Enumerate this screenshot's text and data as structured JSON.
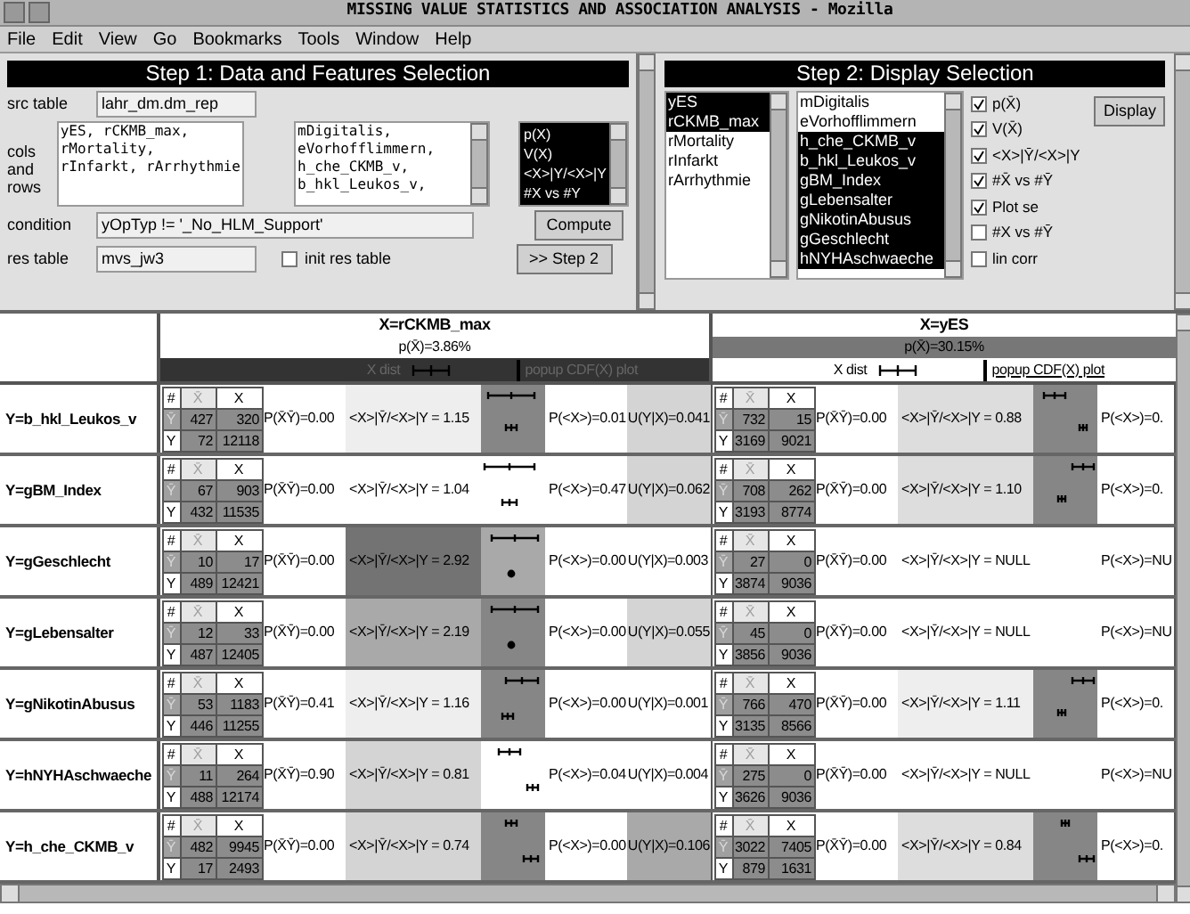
{
  "window": {
    "title": "MISSING VALUE STATISTICS AND ASSOCIATION ANALYSIS - Mozilla"
  },
  "menu": [
    "File",
    "Edit",
    "View",
    "Go",
    "Bookmarks",
    "Tools",
    "Window",
    "Help"
  ],
  "step1": {
    "title": "Step 1: Data and Features Selection",
    "src_label": "src table",
    "src_value": "lahr_dm.dm_rep",
    "cols_label": "cols and rows",
    "cols_value": "yES, rCKMB_max,\nrMortality,\nrInfarkt, rArrhythmie",
    "features_value": "mDigitalis,\neVorhofflimmern,\nh_che_CKMB_v,\nb_hkl_Leukos_v,",
    "stats_options": [
      {
        "label": "p(X)",
        "selected": true
      },
      {
        "label": "V(X)",
        "selected": true
      },
      {
        "label": "<X>|Y/<X>|Y",
        "selected": true
      },
      {
        "label": "#X vs #Y",
        "selected": true
      }
    ],
    "condition_label": "condition",
    "condition_value": "yOpTyp != '_No_HLM_Support'",
    "compute": "Compute",
    "res_label": "res table",
    "res_value": "mvs_jw3",
    "init": {
      "label": "init res table",
      "checked": false
    },
    "next": ">> Step 2"
  },
  "step2": {
    "title": "Step 2: Display Selection",
    "x_items": [
      {
        "label": "yES",
        "selected": true
      },
      {
        "label": "rCKMB_max",
        "selected": true
      },
      {
        "label": "rMortality",
        "selected": false
      },
      {
        "label": "rInfarkt",
        "selected": false
      },
      {
        "label": "rArrhythmie",
        "selected": false
      }
    ],
    "y_items": [
      {
        "label": "mDigitalis",
        "selected": false
      },
      {
        "label": "eVorhofflimmern",
        "selected": false
      },
      {
        "label": "h_che_CKMB_v",
        "selected": true
      },
      {
        "label": "b_hkl_Leukos_v",
        "selected": true
      },
      {
        "label": "gBM_Index",
        "selected": true
      },
      {
        "label": "gLebensalter",
        "selected": true
      },
      {
        "label": "gNikotinAbusus",
        "selected": true
      },
      {
        "label": "gGeschlecht",
        "selected": true
      },
      {
        "label": "hNYHAschwaeche",
        "selected": true
      }
    ],
    "options": [
      {
        "label": "p(X̄)",
        "checked": true
      },
      {
        "label": "V(X̄)",
        "checked": true
      },
      {
        "label": "<X>|Ȳ/<X>|Y",
        "checked": true
      },
      {
        "label": "#X̄ vs #Ȳ",
        "checked": true
      },
      {
        "label": "Plot se",
        "checked": true
      },
      {
        "label": "#X vs #Ȳ",
        "checked": false
      },
      {
        "label": "lin corr",
        "checked": false
      }
    ],
    "display": "Display"
  },
  "table": {
    "columns": [
      {
        "name": "X=rCKMB_max",
        "p": "p(X̄)=3.86%",
        "p_dark": false,
        "dist_dark": true,
        "dist_label": "X dist",
        "cdf_link": "popup CDF(X) plot"
      },
      {
        "name": "X=yES",
        "p": "p(X̄)=30.15%",
        "p_dark": true,
        "dist_dark": false,
        "dist_label": "X dist",
        "cdf_link": "popup CDF(X) plot"
      }
    ],
    "rows": [
      {
        "label": "Y=b_hkl_Leukos_v",
        "cells": [
          {
            "header": [
              "#",
              "X̄",
              "X"
            ],
            "rows": [
              {
                "label": "Ȳ",
                "values": [
                  "427",
                  "320"
                ]
              },
              {
                "label": "Y",
                "values": [
                  "72",
                  "12118"
                ]
              }
            ],
            "p": "P(X̄Ȳ)=0.00",
            "ratio": {
              "text": "<X>|Ȳ/<X>|Y = 1.15",
              "color": "#eeeeee"
            },
            "plot": {
              "kind": "intervals",
              "color": "#868686"
            },
            "mean": "P(<X>)=0.01",
            "u": {
              "text": "U(Y|X)=0.041",
              "color": "#d4d4d4"
            }
          },
          {
            "header": [
              "#",
              "X̄",
              "X"
            ],
            "rows": [
              {
                "label": "Ȳ",
                "values": [
                  "732",
                  "15"
                ]
              },
              {
                "label": "Y",
                "values": [
                  "3169",
                  "9021"
                ]
              }
            ],
            "p": "P(X̄Ȳ)=0.00",
            "ratio": {
              "text": "<X>|Ȳ/<X>|Y = 0.88",
              "color": "#dddddd"
            },
            "plot": {
              "kind": "intervals",
              "color": "#868686"
            },
            "mean": "P(<X>)=0."
          }
        ]
      },
      {
        "label": "Y=gBM_Index",
        "cells": [
          {
            "header": [
              "#",
              "X̄",
              "X"
            ],
            "rows": [
              {
                "label": "Ȳ",
                "values": [
                  "67",
                  "903"
                ]
              },
              {
                "label": "Y",
                "values": [
                  "432",
                  "11535"
                ]
              }
            ],
            "p": "P(X̄Ȳ)=0.00",
            "ratio": {
              "text": "<X>|Ȳ/<X>|Y = 1.04"
            },
            "plot": {
              "kind": "intervals"
            },
            "mean": "P(<X>)=0.47",
            "u": {
              "text": "U(Y|X)=0.062",
              "color": "#d4d4d4"
            }
          },
          {
            "header": [
              "#",
              "X̄",
              "X"
            ],
            "rows": [
              {
                "label": "Ȳ",
                "values": [
                  "708",
                  "262"
                ]
              },
              {
                "label": "Y",
                "values": [
                  "3193",
                  "8774"
                ]
              }
            ],
            "p": "P(X̄Ȳ)=0.00",
            "ratio": {
              "text": "<X>|Ȳ/<X>|Y = 1.10",
              "color": "#dddddd"
            },
            "plot": {
              "kind": "intervals",
              "color": "#868686"
            },
            "mean": "P(<X>)=0."
          }
        ]
      },
      {
        "label": "Y=gGeschlecht",
        "cells": [
          {
            "header": [
              "#",
              "X̄",
              "X"
            ],
            "rows": [
              {
                "label": "Ȳ",
                "values": [
                  "10",
                  "17"
                ]
              },
              {
                "label": "Y",
                "values": [
                  "489",
                  "12421"
                ]
              }
            ],
            "p": "P(X̄Ȳ)=0.00",
            "ratio": {
              "text": "<X>|Ȳ/<X>|Y = 2.92",
              "color": "#737373"
            },
            "plot": {
              "kind": "intervals",
              "color": "#a9a9a9"
            },
            "mean": "P(<X>)=0.00",
            "u": {
              "text": "U(Y|X)=0.003"
            }
          },
          {
            "header": [
              "#",
              "X̄",
              "X"
            ],
            "rows": [
              {
                "label": "Ȳ",
                "values": [
                  "27",
                  "0"
                ]
              },
              {
                "label": "Y",
                "values": [
                  "3874",
                  "9036"
                ]
              }
            ],
            "p": "P(X̄Ȳ)=0.00",
            "ratio": {
              "text": "<X>|Ȳ/<X>|Y = NULL"
            },
            "mean": "P(<X>)=NU"
          }
        ]
      },
      {
        "label": "Y=gLebensalter",
        "cells": [
          {
            "header": [
              "#",
              "X̄",
              "X"
            ],
            "rows": [
              {
                "label": "Ȳ",
                "values": [
                  "12",
                  "33"
                ]
              },
              {
                "label": "Y",
                "values": [
                  "487",
                  "12405"
                ]
              }
            ],
            "p": "P(X̄Ȳ)=0.00",
            "ratio": {
              "text": "<X>|Ȳ/<X>|Y = 2.19",
              "color": "#a9a9a9"
            },
            "plot": {
              "kind": "intervals",
              "color": "#868686"
            },
            "mean": "P(<X>)=0.00",
            "u": {
              "text": "U(Y|X)=0.055",
              "color": "#d4d4d4"
            }
          },
          {
            "header": [
              "#",
              "X̄",
              "X"
            ],
            "rows": [
              {
                "label": "Ȳ",
                "values": [
                  "45",
                  "0"
                ]
              },
              {
                "label": "Y",
                "values": [
                  "3856",
                  "9036"
                ]
              }
            ],
            "p": "P(X̄Ȳ)=0.00",
            "ratio": {
              "text": "<X>|Ȳ/<X>|Y = NULL"
            },
            "mean": "P(<X>)=NU"
          }
        ]
      },
      {
        "label": "Y=gNikotinAbusus",
        "cells": [
          {
            "header": [
              "#",
              "X̄",
              "X"
            ],
            "rows": [
              {
                "label": "Ȳ",
                "values": [
                  "53",
                  "1183"
                ]
              },
              {
                "label": "Y",
                "values": [
                  "446",
                  "11255"
                ]
              }
            ],
            "p": "P(X̄Ȳ)=0.41",
            "ratio": {
              "text": "<X>|Ȳ/<X>|Y = 1.16",
              "color": "#eeeeee"
            },
            "plot": {
              "kind": "intervals",
              "color": "#868686"
            },
            "mean": "P(<X>)=0.00",
            "u": {
              "text": "U(Y|X)=0.001"
            }
          },
          {
            "header": [
              "#",
              "X̄",
              "X"
            ],
            "rows": [
              {
                "label": "Ȳ",
                "values": [
                  "766",
                  "470"
                ]
              },
              {
                "label": "Y",
                "values": [
                  "3135",
                  "8566"
                ]
              }
            ],
            "p": "P(X̄Ȳ)=0.00",
            "ratio": {
              "text": "<X>|Ȳ/<X>|Y = 1.11",
              "color": "#eeeeee"
            },
            "plot": {
              "kind": "intervals",
              "color": "#868686"
            },
            "mean": "P(<X>)=0."
          }
        ]
      },
      {
        "label": "Y=hNYHAschwaeche",
        "cells": [
          {
            "header": [
              "#",
              "X̄",
              "X"
            ],
            "rows": [
              {
                "label": "Ȳ",
                "values": [
                  "11",
                  "264"
                ]
              },
              {
                "label": "Y",
                "values": [
                  "488",
                  "12174"
                ]
              }
            ],
            "p": "P(X̄Ȳ)=0.90",
            "ratio": {
              "text": "<X>|Ȳ/<X>|Y = 0.81",
              "color": "#d4d4d4"
            },
            "plot": {
              "kind": "intervals"
            },
            "mean": "P(<X>)=0.04",
            "u": {
              "text": "U(Y|X)=0.004"
            }
          },
          {
            "header": [
              "#",
              "X̄",
              "X"
            ],
            "rows": [
              {
                "label": "Ȳ",
                "values": [
                  "275",
                  "0"
                ]
              },
              {
                "label": "Y",
                "values": [
                  "3626",
                  "9036"
                ]
              }
            ],
            "p": "P(X̄Ȳ)=0.00",
            "ratio": {
              "text": "<X>|Ȳ/<X>|Y = NULL"
            },
            "mean": "P(<X>)=NU"
          }
        ]
      },
      {
        "label": "Y=h_che_CKMB_v",
        "cells": [
          {
            "header": [
              "#",
              "X̄",
              "X"
            ],
            "rows": [
              {
                "label": "Ȳ",
                "values": [
                  "482",
                  "9945"
                ]
              },
              {
                "label": "Y",
                "values": [
                  "17",
                  "2493"
                ]
              }
            ],
            "p": "P(X̄Ȳ)=0.00",
            "ratio": {
              "text": "<X>|Ȳ/<X>|Y = 0.74",
              "color": "#d4d4d4"
            },
            "plot": {
              "kind": "intervals",
              "color": "#868686"
            },
            "mean": "P(<X>)=0.00",
            "u": {
              "text": "U(Y|X)=0.106",
              "color": "#a9a9a9"
            }
          },
          {
            "header": [
              "#",
              "X̄",
              "X"
            ],
            "rows": [
              {
                "label": "Ȳ",
                "values": [
                  "3022",
                  "7405"
                ]
              },
              {
                "label": "Y",
                "values": [
                  "879",
                  "1631"
                ]
              }
            ],
            "p": "P(X̄Ȳ)=0.00",
            "ratio": {
              "text": "<X>|Ȳ/<X>|Y = 0.84",
              "color": "#dddddd"
            },
            "plot": {
              "kind": "intervals",
              "color": "#868686"
            },
            "mean": "P(<X>)=0."
          }
        ]
      }
    ]
  }
}
